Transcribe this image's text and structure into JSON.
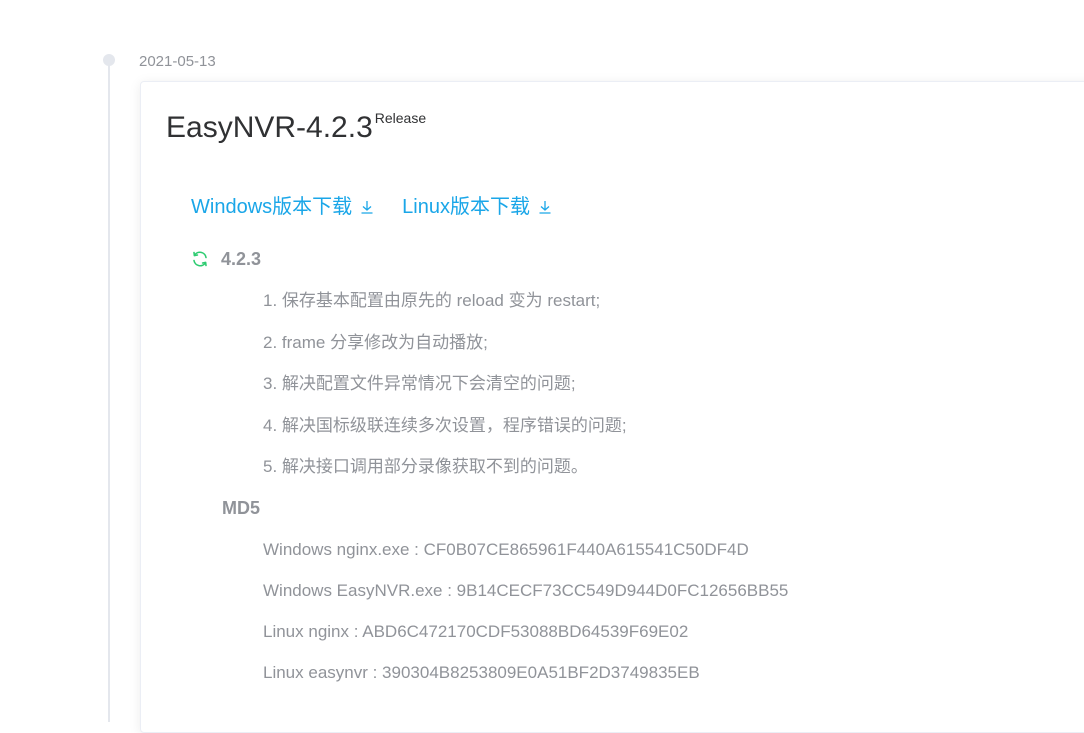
{
  "timeline": {
    "date": "2021-05-13"
  },
  "release": {
    "title": "EasyNVR-4.2.3",
    "tag": "Release"
  },
  "downloads": [
    {
      "label": "Windows版本下载"
    },
    {
      "label": "Linux版本下载"
    }
  ],
  "version": {
    "label": "4.2.3"
  },
  "notes": [
    "1. 保存基本配置由原先的 reload 变为 restart;",
    "2. frame 分享修改为自动播放;",
    "3. 解决配置文件异常情况下会清空的问题;",
    "4. 解决国标级联连续多次设置，程序错误的问题;",
    "5. 解决接口调用部分录像获取不到的问题。"
  ],
  "md5": {
    "heading": "MD5",
    "items": [
      "Windows nginx.exe : CF0B07CE865961F440A615541C50DF4D",
      "Windows EasyNVR.exe : 9B14CECF73CC549D944D0FC12656BB55",
      "Linux nginx : ABD6C472170CDF53088BD64539F69E02",
      "Linux easynvr : 390304B8253809E0A51BF2D3749835EB"
    ]
  },
  "colors": {
    "link": "#1aa6e8",
    "sync_icon": "#2ecc71",
    "muted_text": "#909399"
  },
  "icons": {
    "download": "download-icon",
    "sync": "sync-icon",
    "timeline_dot": "timeline-dot"
  }
}
